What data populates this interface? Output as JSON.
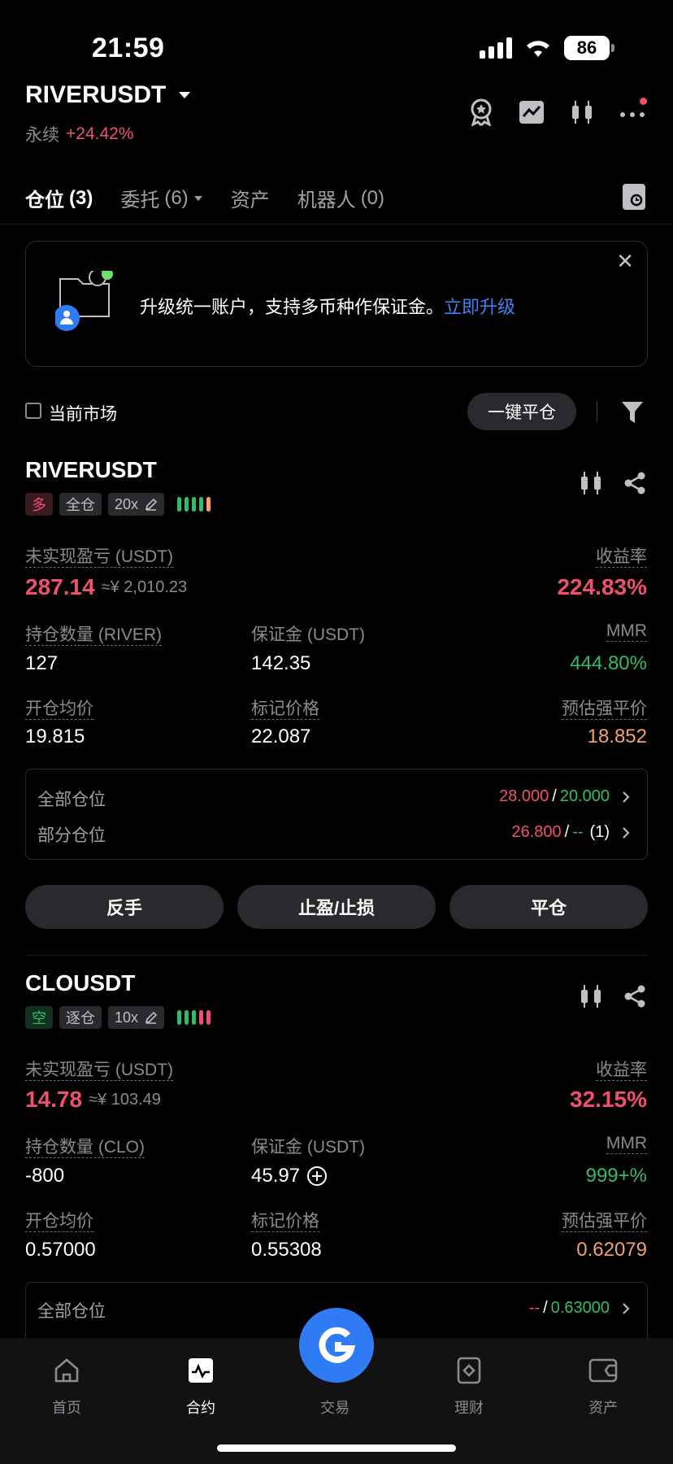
{
  "status_bar": {
    "time": "21:59",
    "battery": "86"
  },
  "header": {
    "symbol": "RIVERUSDT",
    "type_label": "永续",
    "change": "+24.42%"
  },
  "tabs": [
    {
      "label": "仓位",
      "count": "(3)"
    },
    {
      "label": "委托",
      "count": "(6)"
    },
    {
      "label": "资产",
      "count": ""
    },
    {
      "label": "机器人",
      "count": "(0)"
    }
  ],
  "banner": {
    "text": "升级统一账户，支持多币种作保证金。",
    "link": "立即升级"
  },
  "filter": {
    "current_market": "当前市场",
    "close_all": "一键平仓"
  },
  "positions": [
    {
      "symbol": "RIVERUSDT",
      "side": "多",
      "margin_mode": "全仓",
      "leverage": "20x",
      "pnl_label": "未实现盈亏 (USDT)",
      "pnl": "287.14",
      "pnl_cny": "≈¥ 2,010.23",
      "roe_label": "收益率",
      "roe": "224.83%",
      "qty_label": "持仓数量 (RIVER)",
      "qty": "127",
      "margin_label": "保证金 (USDT)",
      "margin": "142.35",
      "mmr_label": "MMR",
      "mmr": "444.80%",
      "entry_label": "开仓均价",
      "entry": "19.815",
      "mark_label": "标记价格",
      "mark": "22.087",
      "liq_label": "预估强平价",
      "liq": "18.852",
      "summary": {
        "all_label": "全部仓位",
        "all_tp": "28.000",
        "all_sl": "20.000",
        "partial_label": "部分仓位",
        "partial_tp": "26.800",
        "partial_sl": "--",
        "partial_count": "(1)"
      },
      "actions": [
        "反手",
        "止盈/止损",
        "平仓"
      ]
    },
    {
      "symbol": "CLOUSDT",
      "side": "空",
      "margin_mode": "逐仓",
      "leverage": "10x",
      "pnl_label": "未实现盈亏 (USDT)",
      "pnl": "14.78",
      "pnl_cny": "≈¥ 103.49",
      "roe_label": "收益率",
      "roe": "32.15%",
      "qty_label": "持仓数量 (CLO)",
      "qty": "-800",
      "margin_label": "保证金 (USDT)",
      "margin": "45.97",
      "mmr_label": "MMR",
      "mmr": "999+%",
      "entry_label": "开仓均价",
      "entry": "0.57000",
      "mark_label": "标记价格",
      "mark": "0.55308",
      "liq_label": "预估强平价",
      "liq": "0.62079",
      "summary": {
        "all_label": "全部仓位",
        "all_tp": "--",
        "all_sl": "0.63000"
      }
    }
  ],
  "nav": [
    {
      "label": "首页",
      "icon": "home-icon"
    },
    {
      "label": "合约",
      "icon": "futures-icon"
    },
    {
      "label": "交易",
      "icon": "trade-icon"
    },
    {
      "label": "理财",
      "icon": "earn-icon"
    },
    {
      "label": "资产",
      "icon": "wallet-icon"
    }
  ],
  "colors": {
    "up": "#f0506e",
    "down": "#2ebd6b",
    "warn": "#f5a06b",
    "accent": "#2f7bf5"
  }
}
